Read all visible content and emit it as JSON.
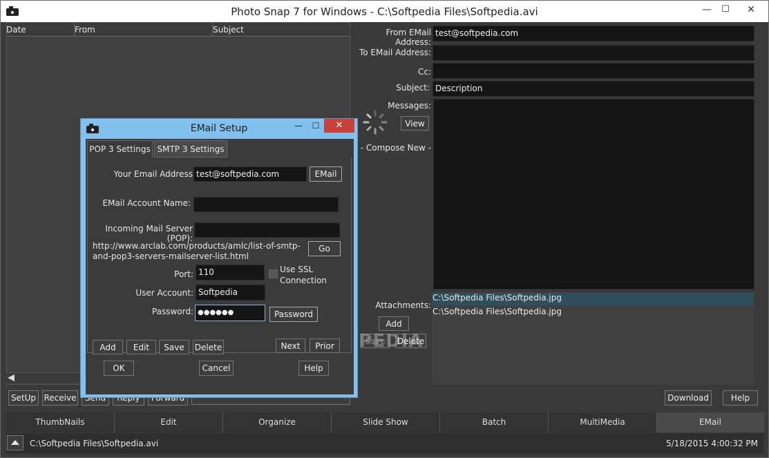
{
  "window": {
    "title": "Photo Snap 7 for Windows - C:\\Softpedia Files\\Softpedia.avi",
    "minimize": "—",
    "maximize": "☐",
    "close": "✕"
  },
  "list": {
    "columns": [
      "Date",
      "From",
      "Subject"
    ]
  },
  "email_form": {
    "from_label": "From EMail Address:",
    "from_value": "test@softpedia.com",
    "to_label": "To EMail Address:",
    "to_value": "",
    "cc_label": "Cc:",
    "cc_value": "",
    "subject_label": "Subject:",
    "subject_value": "Description",
    "messages_label": "Messages:",
    "view_button": "View",
    "compose_label": "- Compose New -",
    "attachments_label": "Attachments:",
    "attachments": [
      "C:\\Softpedia Files\\Softpedia.jpg",
      "C:\\Softpedia Files\\Softpedia.jpg"
    ],
    "add_button": "Add",
    "save_button": "Save",
    "delete_button": "Delete"
  },
  "bottom_buttons": {
    "setup": "SetUp",
    "receive": "Receive",
    "send": "Send",
    "reply": "Reply",
    "forward": "Forward",
    "download": "Download",
    "help": "Help"
  },
  "tabs": [
    "ThumbNails",
    "Edit",
    "Organize",
    "Slide Show",
    "Batch",
    "MultiMedia",
    "EMail"
  ],
  "active_tab": "EMail",
  "status": {
    "path": "C:\\Softpedia Files\\Softpedia.avi",
    "datetime": "5/18/2015 4:00:32 PM"
  },
  "dialog": {
    "title": "EMail Setup",
    "tab_pop": "POP 3 Settings",
    "tab_smtp": "SMTP 3 Settings",
    "your_email_label": "Your Email Address:",
    "your_email_value": "test@softpedia.com",
    "email_button": "EMail",
    "account_name_label": "EMail Account Name:",
    "account_name_value": "",
    "incoming_label": "Incoming Mail Server (POP):",
    "incoming_value": "",
    "link_text": "http://www.arclab.com/products/amlc/list-of-smtp-and-pop3-servers-mailserver-list.html",
    "go_button": "Go",
    "port_label": "Port:",
    "port_value": "110",
    "ssl_label": "Use SSL Connection",
    "user_label": "User Account:",
    "user_value": "Softpedia",
    "password_label": "Password:",
    "password_value": "●●●●●●",
    "password_button": "Password",
    "add": "Add",
    "edit": "Edit",
    "save": "Save",
    "delete": "Delete",
    "next": "Next",
    "prior": "Prior",
    "ok": "OK",
    "cancel": "Cancel",
    "help": "Help"
  },
  "watermark": "SOFTPEDIA"
}
